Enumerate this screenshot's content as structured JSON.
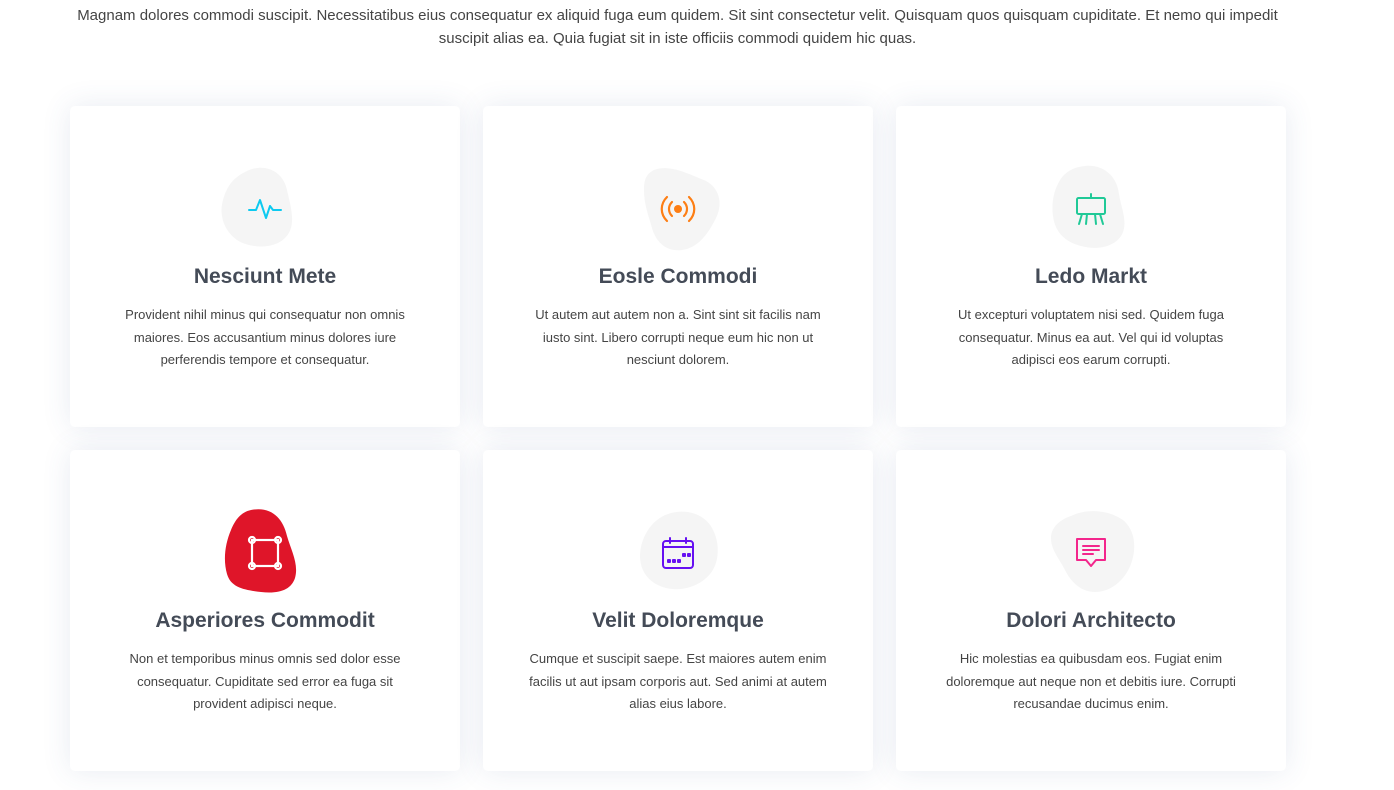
{
  "intro": {
    "text": "Magnam dolores commodi suscipit. Necessitatibus eius consequatur ex aliquid fuga eum quidem. Sit sint consectetur velit. Quisquam quos quisquam cupiditate. Et nemo qui impedit suscipit alias ea. Quia fugiat sit in iste officiis commodi quidem hic quas."
  },
  "cards": [
    {
      "title": "Nesciunt Mete",
      "description": "Provident nihil minus qui consequatur non omnis maiores. Eos accusantium minus dolores iure perferendis tempore et consequatur.",
      "icon": "activity-icon",
      "accent": "#0dcaf0",
      "blob": "#f5f5f5"
    },
    {
      "title": "Eosle Commodi",
      "description": "Ut autem aut autem non a. Sint sint sit facilis nam iusto sint. Libero corrupti neque eum hic non ut nesciunt dolorem.",
      "icon": "broadcast-icon",
      "accent": "#fd7e14",
      "blob": "#f5f5f5"
    },
    {
      "title": "Ledo Markt",
      "description": "Ut excepturi voluptatem nisi sed. Quidem fuga consequatur. Minus ea aut. Vel qui id voluptas adipisci eos earum corrupti.",
      "icon": "easel-icon",
      "accent": "#20c997",
      "blob": "#f5f5f5"
    },
    {
      "title": "Asperiores Commodit",
      "description": "Non et temporibus minus omnis sed dolor esse consequatur. Cupiditate sed error ea fuga sit provident adipisci neque.",
      "icon": "bounding-box-icon",
      "accent": "#ffffff",
      "blob": "#df1529"
    },
    {
      "title": "Velit Doloremque",
      "description": "Cumque et suscipit saepe. Est maiores autem enim facilis ut aut ipsam corporis aut. Sed animi at autem alias eius labore.",
      "icon": "calendar-icon",
      "accent": "#6610f2",
      "blob": "#f5f5f5"
    },
    {
      "title": "Dolori Architecto",
      "description": "Hic molestias ea quibusdam eos. Fugiat enim doloremque aut neque non et debitis iure. Corrupti recusandae ducimus enim.",
      "icon": "chat-square-text-icon",
      "accent": "#f3268c",
      "blob": "#f5f5f5"
    }
  ]
}
